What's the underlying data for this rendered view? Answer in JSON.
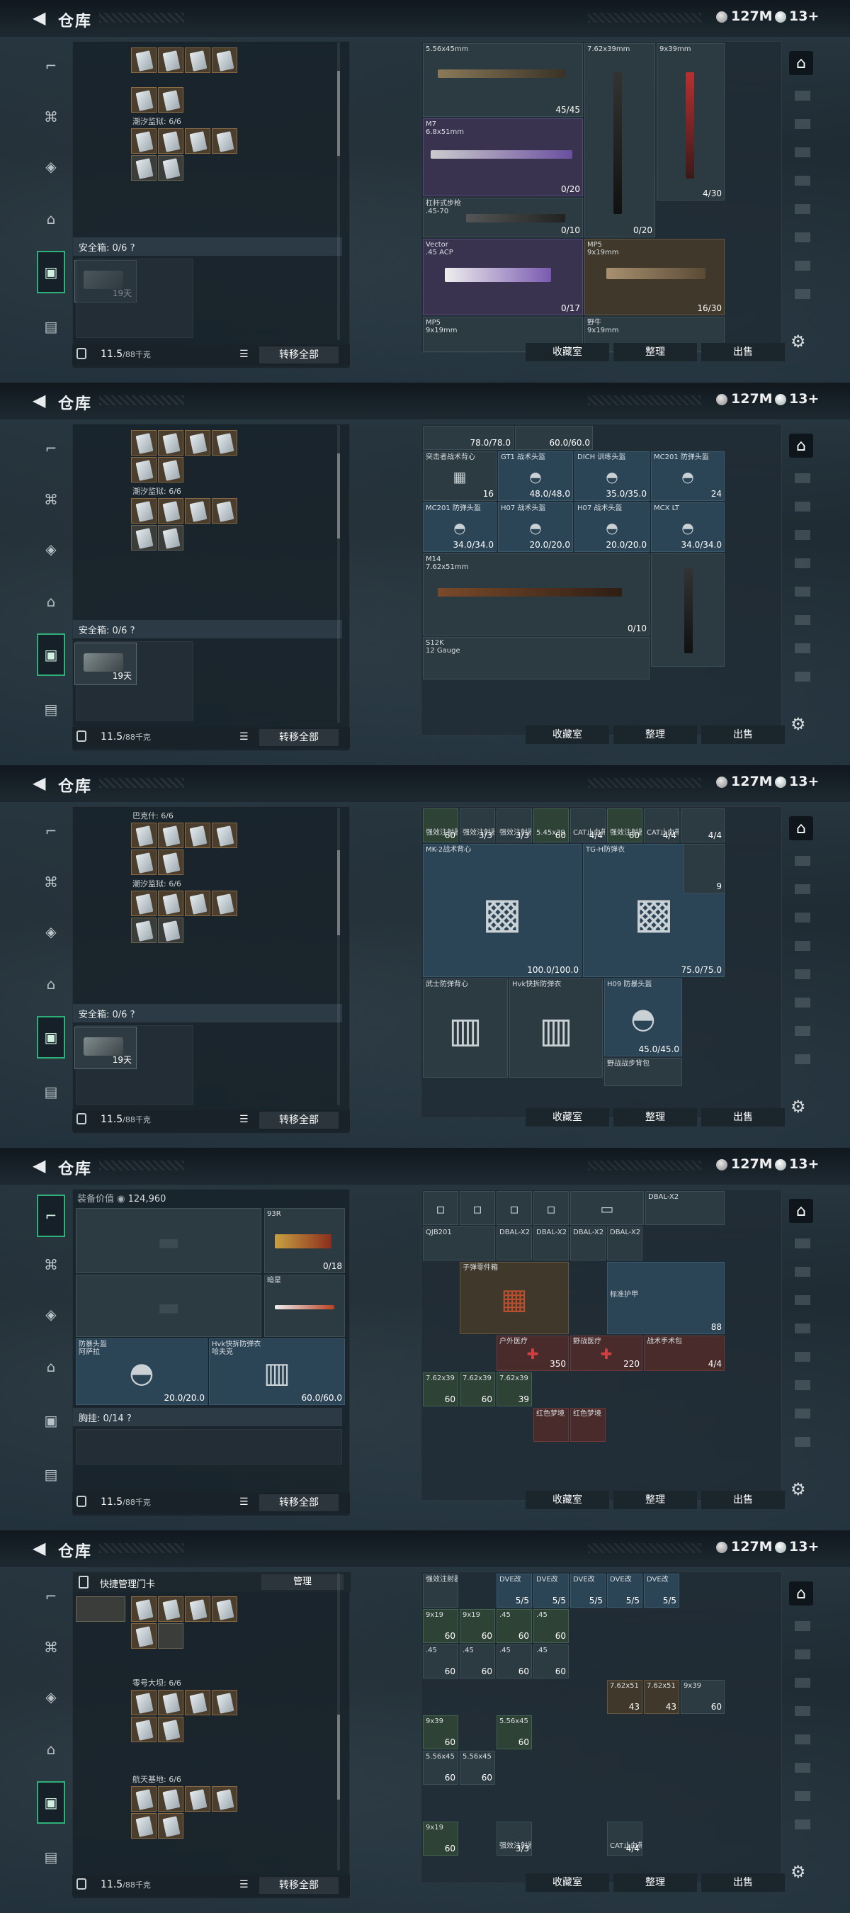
{
  "header": {
    "back_glyph": "◀",
    "title": "仓库",
    "money": "127M",
    "gems": "13",
    "gems_plus": "+"
  },
  "bottom": {
    "weight": "11.5",
    "weight_unit": "/88千克",
    "move_all": "转移全部"
  },
  "buttons": {
    "collection": "收藏室",
    "sort": "整理",
    "sell": "出售",
    "manage": "管理"
  },
  "left": {
    "secure_box": "安全箱: 0/6 ?",
    "secure_time": "19天",
    "group1_label": "潮汐监狱: 6/6",
    "group2_label": "巴克什: 6/6",
    "quick_title": "快捷管理门卡",
    "group_zero": "零号大坝: 6/6",
    "group_space": "航天基地: 6/6",
    "equip_value_label": "装备价值",
    "equip_value": "124,960",
    "chest": "胸挂: 0/14 ?",
    "helmet_name": "防暴头盔",
    "helmet_sub": "阿萨拉",
    "helmet_dur": "20.0/20.0",
    "armor_name": "Hvk快拆防弹衣",
    "armor_sub": "哈夫克",
    "armor_dur": "60.0/60.0",
    "pistol_name": "93R",
    "pistol_count": "0/18",
    "knife_name": "暗星"
  },
  "p1": [
    {
      "n": "5.56x45mm",
      "c": "45/45"
    },
    {
      "n": "7.62x39mm",
      "c": "0/20"
    },
    {
      "n": "9x39mm",
      "c": "4/30"
    },
    {
      "n": "M7",
      "c": ""
    },
    {
      "n": "6.8x51mm",
      "c": "0/20"
    },
    {
      "n": "杠杆式步枪",
      "c": ""
    },
    {
      "n": ".45-70",
      "c": "0/10"
    },
    {
      "n": "Vector",
      "c": ""
    },
    {
      "n": ".45 ACP",
      "c": "0/17"
    },
    {
      "n": "MP5",
      "c": ""
    },
    {
      "n": "9x19mm",
      "c": "16/30"
    },
    {
      "n": "野牛",
      "c": ""
    }
  ],
  "p2": [
    {
      "n": "",
      "c": "78.0/78.0"
    },
    {
      "n": "",
      "c": "60.0/60.0"
    },
    {
      "n": "突击者战术背心",
      "c": "16"
    },
    {
      "n": "GT1 战术头盔",
      "c": "48.0/48.0"
    },
    {
      "n": "DICH 训练头盔",
      "c": "35.0/35.0"
    },
    {
      "n": "MC201 防弹头盔",
      "c": "24"
    },
    {
      "n": "MC201 防弹头盔",
      "c": "34.0/34.0"
    },
    {
      "n": "H07 战术头盔",
      "c": "20.0/20.0"
    },
    {
      "n": "H07 战术头盔",
      "c": "20.0/20.0"
    },
    {
      "n": "MCX LT",
      "c": "34.0/34.0"
    },
    {
      "n": "M14",
      "c": ""
    },
    {
      "n": "7.62x51mm",
      "c": "0/10"
    },
    {
      "n": "S12K",
      "c": ""
    },
    {
      "n": "12 Gauge",
      "c": ""
    }
  ],
  "p3": [
    {
      "n": "强效注射器",
      "c": "60"
    },
    {
      "n": "强效注射器",
      "c": "3/3"
    },
    {
      "n": "5.45x39",
      "c": "60"
    },
    {
      "n": "CAT止血带",
      "c": "4/4"
    },
    {
      "n": "MK-2战术背心",
      "c": "9"
    },
    {
      "n": "TG-H防弹衣",
      "c": ""
    },
    {
      "n": "",
      "c": "100.0/100.0"
    },
    {
      "n": "",
      "c": "75.0/75.0"
    },
    {
      "n": "武士防弹背心",
      "c": ""
    },
    {
      "n": "Hvk快拆防弹衣",
      "c": ""
    },
    {
      "n": "H09 防暴头盔",
      "c": "45.0/45.0"
    },
    {
      "n": "野战战步背包",
      "c": ""
    }
  ],
  "p4": [
    {
      "n": "QJB201",
      "c": ""
    },
    {
      "n": "DBAL-X2",
      "c": ""
    },
    {
      "n": "子弹零件箱",
      "c": ""
    },
    {
      "n": "标准护甲",
      "c": "88"
    },
    {
      "n": "户外医疗",
      "c": "350"
    },
    {
      "n": "野战医疗",
      "c": "220"
    },
    {
      "n": "野战医疗",
      "c": "220"
    },
    {
      "n": "战术手术包",
      "c": "4/4"
    },
    {
      "n": "7.62x39",
      "c": "60"
    },
    {
      "n": "7.62x39",
      "c": "39"
    },
    {
      "n": "红色梦境",
      "c": ""
    }
  ],
  "p5": [
    {
      "n": "9x19",
      "c": "60"
    },
    {
      "n": "DVE改",
      "c": "5/5"
    },
    {
      "n": ".45",
      "c": "60"
    },
    {
      "n": "7.62x51",
      "c": "43"
    },
    {
      "n": "9x39",
      "c": "60"
    },
    {
      "n": "5.56x45",
      "c": "60"
    },
    {
      "n": "强效注射器",
      "c": "3/3"
    },
    {
      "n": "CAT止血带",
      "c": "4/4"
    }
  ]
}
